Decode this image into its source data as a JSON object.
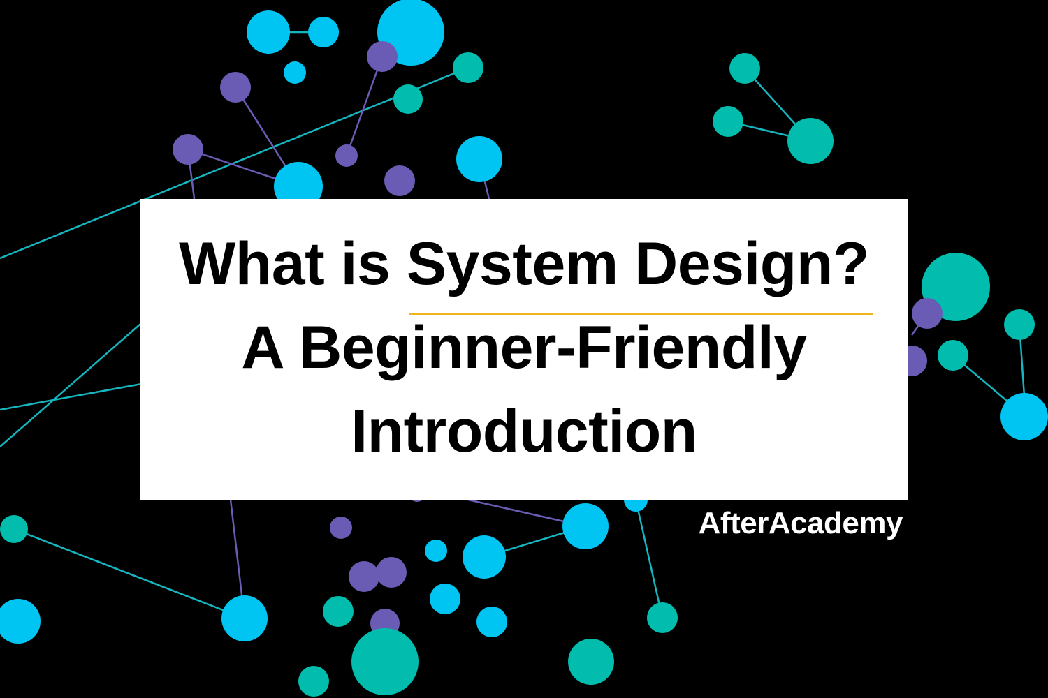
{
  "title": {
    "line1_prefix": "What is ",
    "line1_highlight": "System Design?",
    "line2": "A Beginner-Friendly",
    "line3": "Introduction"
  },
  "brand": "AfterAcademy",
  "colors": {
    "background": "#000000",
    "card": "#ffffff",
    "text": "#000000",
    "underline": "#f0b41c",
    "node_cyan": "#00c4f2",
    "node_teal": "#02bcae",
    "node_purple": "#6a5cb5",
    "edge_teal": "#15b6c0",
    "edge_purple": "#6a5cb5"
  }
}
